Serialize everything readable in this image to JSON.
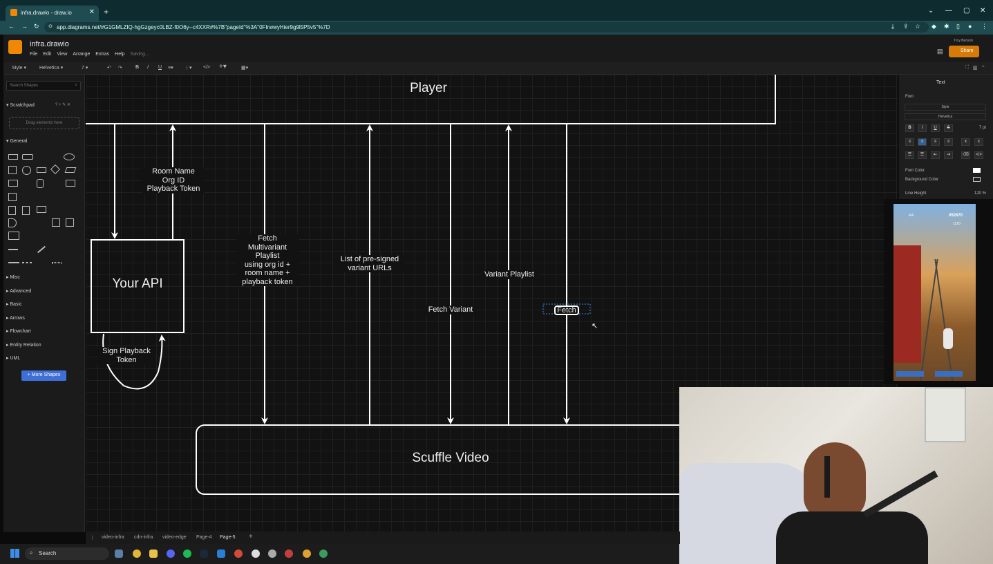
{
  "browser": {
    "tab_title": "infra.drawio - draw.io",
    "new_tab": "+",
    "url": "app.diagrams.net/#G1GMLZIQ-hgGzgeyc0LBZ-f0O6y--c4XXR#%7B\"pageId\"%3A\"0FIrwwyHier9g9l5P5v5\"%7D",
    "win_controls": [
      "⌄",
      "—",
      "▢",
      "✕"
    ]
  },
  "app": {
    "doc_title": "infra.drawio",
    "menu": [
      "File",
      "Edit",
      "View",
      "Arrange",
      "Extras",
      "Help"
    ],
    "saving": "Saving...",
    "user": "Troy Benson",
    "share_label": "Share"
  },
  "toolbar": {
    "style": "Style",
    "font": "Helvetica",
    "size": "7"
  },
  "shapes_panel": {
    "search_placeholder": "Search Shapes",
    "scratchpad": "Scratchpad",
    "drag_hint": "Drag elements here",
    "general": "General",
    "sections": [
      "Misc",
      "Advanced",
      "Basic",
      "Arrows",
      "Flowchart",
      "Entity Relation",
      "UML"
    ],
    "more_shapes": "+ More Shapes"
  },
  "diagram": {
    "player": "Player",
    "your_api": "Your API",
    "scuffle_video": "Scuffle Video",
    "room_name": "Room Name\nOrg ID\nPlayback Token",
    "sign_playback": "Sign Playback\nToken",
    "fetch_multivariant": "Fetch\nMultivariant\nPlaylist\nusing org id +\nroom name +\nplayback token",
    "presigned": "List of pre-signed\nvariant URLs",
    "fetch_variant": "Fetch Variant",
    "variant_playlist": "Variant Playlist",
    "fetch": "Fetch"
  },
  "format_panel": {
    "tab": "Text",
    "font_header": "Font",
    "style": "Style",
    "font": "Helvetica",
    "size": "7 pt",
    "font_color": "Font Color",
    "background_color": "Background Color",
    "line_height": "Line Height",
    "line_height_value": "120 %"
  },
  "pages": [
    "video-infra",
    "cdn-infra",
    "video-edge",
    "Page-4",
    "Page-5"
  ],
  "taskbar": {
    "search": "Search"
  },
  "game_hud": {
    "score": "052670",
    "coins": "1120",
    "multiplier": "4/4"
  }
}
